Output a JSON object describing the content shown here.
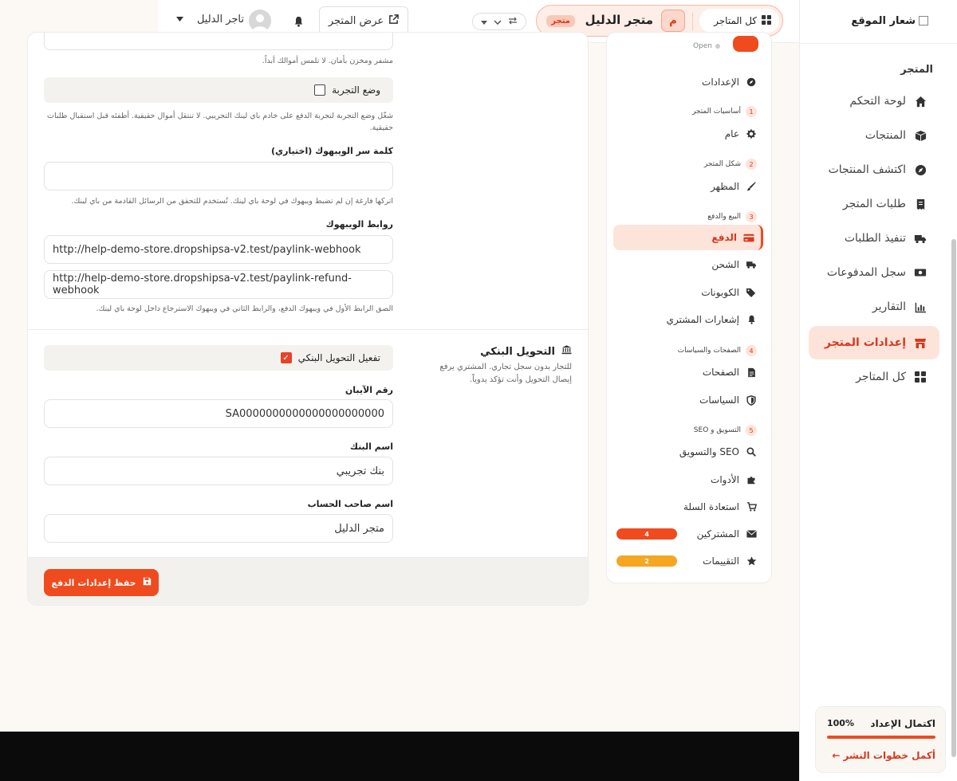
{
  "sidebar": {
    "logo_text": "شعار الموقع",
    "section": "المتجر",
    "items": [
      {
        "label": "لوحة التحكم",
        "icon": "home-icon"
      },
      {
        "label": "المنتجات",
        "icon": "box-icon"
      },
      {
        "label": "اكتشف المنتجات",
        "icon": "compass-icon"
      },
      {
        "label": "طلبات المتجر",
        "icon": "receipt-icon"
      },
      {
        "label": "تنفيذ الطلبات",
        "icon": "truck-icon"
      },
      {
        "label": "سجل المدفوعات",
        "icon": "money-icon"
      },
      {
        "label": "التقارير",
        "icon": "chart-icon"
      },
      {
        "label": "إعدادات المتجر",
        "icon": "store-icon",
        "active": true
      },
      {
        "label": "كل المتاجر",
        "icon": "grid-icon"
      }
    ],
    "progress": {
      "title": "اكتمال الإعداد",
      "value": "100%",
      "fraction": 1.0,
      "link": "أكمل خطوات النشر ←"
    }
  },
  "header": {
    "all_stores": "كل المتاجر",
    "store_initial": "م",
    "store_name": "متجر الدليل",
    "store_badge": "متجر",
    "view_store": "عرض المتجر",
    "user_name": "تاجر الدليل"
  },
  "settings_nav": {
    "open_label": "Open",
    "settings": "الإعدادات",
    "groups": [
      {
        "num": "1",
        "title": "أساسيات المتجر"
      },
      {
        "num": "2",
        "title": "شكل المتجر"
      },
      {
        "num": "3",
        "title": "البيع والدفع"
      },
      {
        "num": "4",
        "title": "الصفحات والسياسات"
      },
      {
        "num": "5",
        "title": "التسويق و SEO"
      }
    ],
    "items": {
      "general": "عام",
      "appearance": "المظهر",
      "payment": "الدفع",
      "shipping": "الشحن",
      "coupons": "الكوبونات",
      "customer_notifications": "إشعارات المشتري",
      "pages": "الصفحات",
      "policies": "السياسات",
      "seo": "SEO والتسويق",
      "tools": "الأدوات",
      "cart_recovery": "استعادة السلة",
      "subscribers": "المشتركين",
      "reviews": "التقييمات"
    },
    "counts": {
      "subscribers": "4",
      "reviews": "2"
    },
    "colors": {
      "subscribers": "#ef4b1f",
      "reviews": "#f5a623"
    }
  },
  "main": {
    "secret_help": "مشفر ومخزن بأمان. لا تلمس أموالك أبداً.",
    "test_mode_label": "وضع التجربة",
    "test_mode_help": "شغّل وضع التجربة لتجربة الدفع على خادم باي لينك التجريبي. لا تنتقل أموال حقيقية. أطفئه قبل استقبال طلبات حقيقية.",
    "webhook_secret_label": "كلمة سر الويبهوك (اختياري)",
    "webhook_secret_value": "",
    "webhook_secret_help": "اتركها فارغة إن لم تضبط ويبهوك في لوحة باي لينك. تُستخدم للتحقق من الرسائل القادمة من باي لينك.",
    "webhook_links_label": "روابط الويبهوك",
    "webhook_url": "http://help-demo-store.dropshipsa-v2.test/paylink-webhook",
    "refund_webhook_url": "http://help-demo-store.dropshipsa-v2.test/paylink-refund-webhook",
    "webhook_links_help": "الصق الرابط الأول في ويبهوك الدفع، والرابط الثاني في ويبهوك الاسترجاع داخل لوحة باي لينك.",
    "bank_title": "التحويل البنكي",
    "bank_desc": "للتجار بدون سجل تجاري. المشتري يرفع إيصال التحويل وأنت تؤكد يدوياً.",
    "bank_enable_label": "تفعيل التحويل البنكي",
    "iban_label": "رقم الآيبان",
    "iban_value": "SA0000000000000000000000",
    "bank_name_label": "اسم البنك",
    "bank_name_value": "بنك تجريبي",
    "account_holder_label": "اسم صاحب الحساب",
    "account_holder_value": "متجر الدليل",
    "save_button": "حفظ إعدادات الدفع"
  },
  "colors": {
    "accent": "#ef4b1f",
    "active_bg": "#fde4db",
    "warning": "#f5a623"
  }
}
